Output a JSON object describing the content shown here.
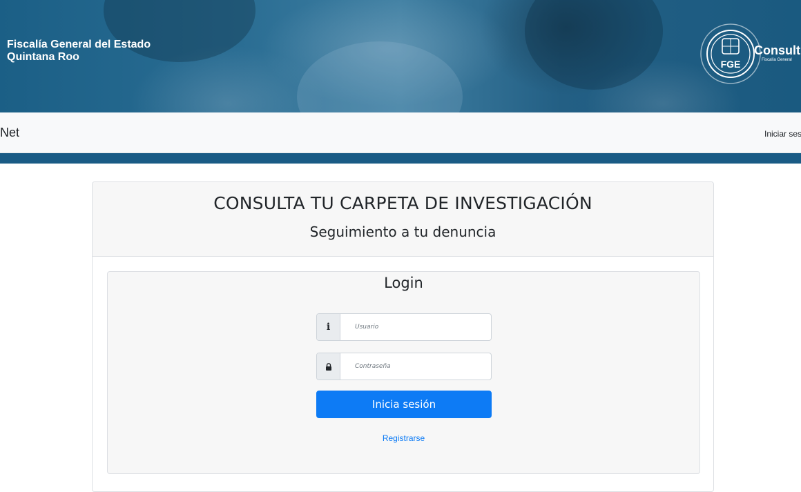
{
  "banner": {
    "org_line1": "Fiscalía General del Estado",
    "org_line2": "Quintana Roo",
    "logo": {
      "emblem_text": "FGE",
      "label": "Consult",
      "sublabel": "Fiscalía General"
    }
  },
  "navbar": {
    "brand": "Net",
    "login_link": "Iniciar ses"
  },
  "card": {
    "title": "CONSULTA TU CARPETA DE INVESTIGACIÓN",
    "subtitle": "Seguimiento a tu denuncia",
    "login": {
      "heading": "Login",
      "user_placeholder": "Usuario",
      "user_value": "",
      "password_placeholder": "Contraseña",
      "password_value": "",
      "submit_label": "Inicia sesión",
      "register_label": "Registrarse"
    }
  },
  "colors": {
    "banner_blue": "#1b5f86",
    "bar_blue": "#1a5b85",
    "primary": "#0d7bf5",
    "panel_bg": "#f7f7f7"
  },
  "icons": {
    "user_addon": "info-icon",
    "password_addon": "lock-icon"
  }
}
